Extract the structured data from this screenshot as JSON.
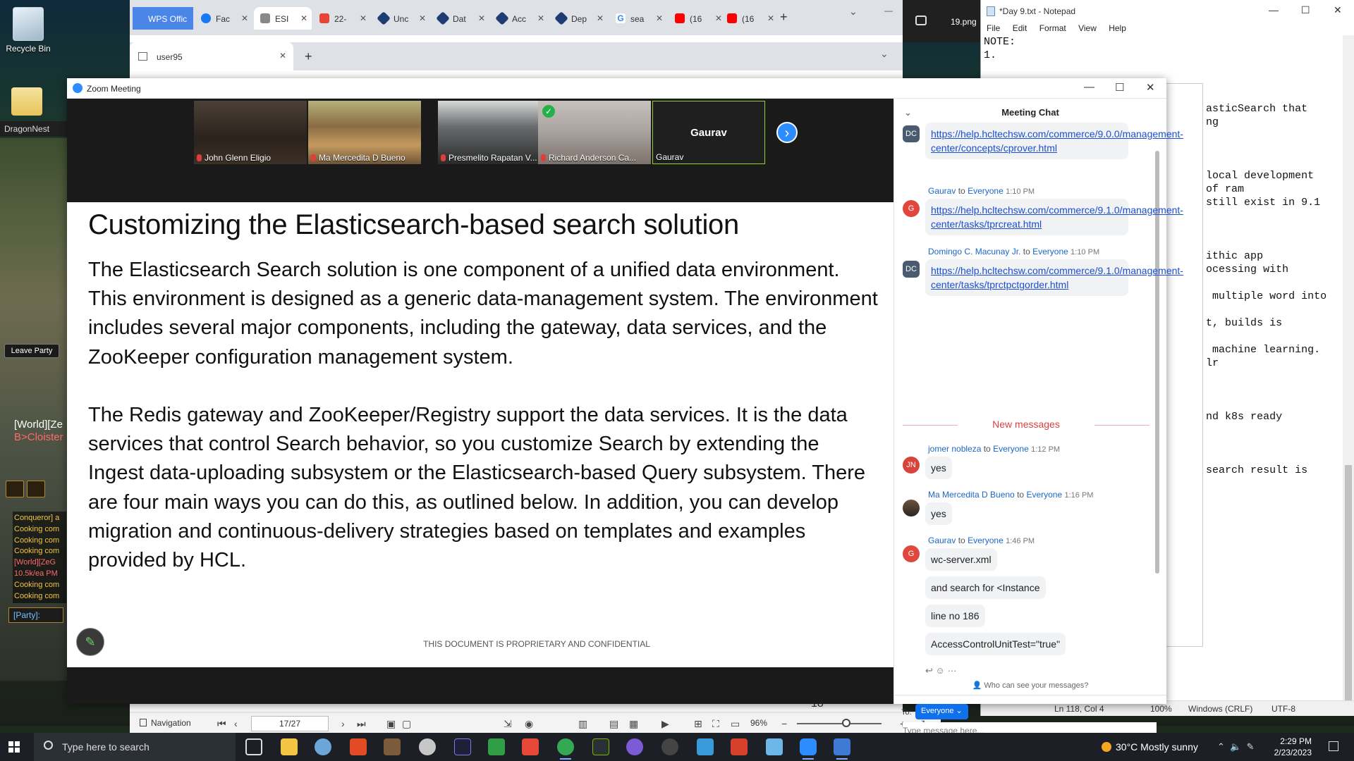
{
  "desktop": {
    "recycle_bin": "Recycle Bin",
    "dragonnest": "DragonNest",
    "leave_party": "Leave Party",
    "world_line1": "[World][Ze",
    "world_line2": "B>Cloister",
    "game_chat": [
      "Conqueror] a",
      "Cooking com",
      "Cooking com",
      "Cooking com",
      "[World][ZeG",
      "10.5k/ea PM",
      "Cooking com",
      "Cooking com"
    ],
    "party": "[Party]:"
  },
  "browser": {
    "tabs": [
      {
        "label": "WPS Offic"
      },
      {
        "label": "Fac",
        "icon": "facebook-icon",
        "color": "#1877f2"
      },
      {
        "label": "ESI",
        "icon": "building-icon",
        "color": "#888888"
      },
      {
        "label": "22-",
        "icon": "gmail-icon",
        "color": "#ea4335"
      },
      {
        "label": "Unc",
        "icon": "diamond-icon",
        "color": "#1f3b73"
      },
      {
        "label": "Dat",
        "icon": "diamond-icon",
        "color": "#1f3b73"
      },
      {
        "label": "Acc",
        "icon": "diamond-icon",
        "color": "#1f3b73"
      },
      {
        "label": "Dep",
        "icon": "diamond-icon",
        "color": "#1f3b73"
      },
      {
        "label": "sea",
        "icon": "google-icon",
        "color": "#4285f4"
      },
      {
        "label": "(16",
        "icon": "youtube-icon",
        "color": "#ff0000"
      },
      {
        "label": "(16",
        "icon": "youtube-icon",
        "color": "#ff0000"
      }
    ],
    "second_window_tab": "user95",
    "image_viewer_file": "19.png"
  },
  "pdf_toolbar": {
    "navigation": "Navigation",
    "page": "17/27",
    "zoom": "96%",
    "page_number_behind": "18"
  },
  "notepad": {
    "title": "*Day 9.txt - Notepad",
    "menu": [
      "File",
      "Edit",
      "Format",
      "View",
      "Help"
    ],
    "lines": [
      "NOTE:",
      "1.",
      "",
      "",
      "",
      "                                   asticSearch that",
      "                                   ng",
      "",
      "",
      "",
      "                                   local development",
      "                                   of ram",
      "                                   still exist in 9.1",
      "",
      "",
      "",
      "                                   ithic app",
      "                                   ocessing with",
      "",
      "                                    multiple word into",
      "",
      "                                   t, builds is",
      "",
      "                                    machine learning.",
      "                                   lr",
      "",
      "",
      "",
      "                                   nd k8s ready",
      "",
      "",
      "",
      "                                   search result is"
    ],
    "status_pos": "Ln 118, Col 4",
    "status_zoom": "100%",
    "status_eol": "Windows (CRLF)",
    "status_enc": "UTF-8"
  },
  "zoom": {
    "title": "Zoom Meeting",
    "participants": [
      {
        "name": "John Glenn Eligio"
      },
      {
        "name": "Ma Mercedita D Bueno"
      },
      {
        "name": "Presmelito Rapatan V..."
      },
      {
        "name": "Richard Anderson Ca..."
      },
      {
        "name": "Gaurav",
        "display": "Gaurav"
      }
    ],
    "slide": {
      "title": "Customizing the Elasticsearch-based search solution",
      "para1": "The Elasticsearch Search solution is one component of a unified data environment. This environment is designed as a generic data-management system. The environment includes several major components, including the gateway, data services, and the ZooKeeper configuration management system.",
      "para2": "The Redis gateway and ZooKeeper/Registry support the data services. It is the data services that control Search behavior, so you customize Search by extending the Ingest data-uploading subsystem or the Elasticsearch-based Query subsystem. There are four main ways you can do this, as outlined below. In addition, you can develop migration and continuous-delivery strategies based on templates and examples provided by HCL.",
      "footer": "THIS DOCUMENT IS PROPRIETARY AND CONFIDENTIAL"
    },
    "chat": {
      "title": "Meeting Chat",
      "to_word": "to",
      "messages": {
        "m0_link": "https://help.hcltechsw.com/commerce/9.0.0/management-center/concepts/cprover.html",
        "m1_sender": "Gaurav",
        "m1_to": "Everyone",
        "m1_time": "1:10 PM",
        "m1_link": "https://help.hcltechsw.com/commerce/9.1.0/management-center/tasks/tprcreat.html",
        "m2_sender": "Domingo C. Macunay Jr.",
        "m2_to": "Everyone",
        "m2_time": "1:10 PM",
        "m2_link": "https://help.hcltechsw.com/commerce/9.1.0/management-center/tasks/tprctpctgorder.html",
        "new_messages": "New messages",
        "m3_sender": "jomer nobleza",
        "m3_to": "Everyone",
        "m3_time": "1:12 PM",
        "m3_text": "yes",
        "m4_sender": "Ma Mercedita D Bueno",
        "m4_to": "Everyone",
        "m4_time": "1:16 PM",
        "m4_text": "yes",
        "m5_sender": "Gaurav",
        "m5_to": "Everyone",
        "m5_time": "1:46 PM",
        "m5_text1": "wc-server.xml",
        "m5_text2": "and search for <Instance",
        "m5_text3": "line no 186",
        "m5_text4": "AccessControlUnitTest=\"true\""
      },
      "avatars": {
        "dc": "DC",
        "g": "G",
        "jn": "JN"
      },
      "who_can_see": "Who can see your messages?",
      "to_label": "To:",
      "to_value": "Everyone",
      "input_placeholder": "Type message here..."
    }
  },
  "taskbar": {
    "search_placeholder": "Type here to search",
    "weather": "30°C  Mostly sunny",
    "time": "2:29 PM",
    "date": "2/23/2023"
  },
  "colors": {
    "zoom_blue": "#0e71eb",
    "link_blue": "#1b4fd1",
    "new_messages_red": "#d94040"
  }
}
